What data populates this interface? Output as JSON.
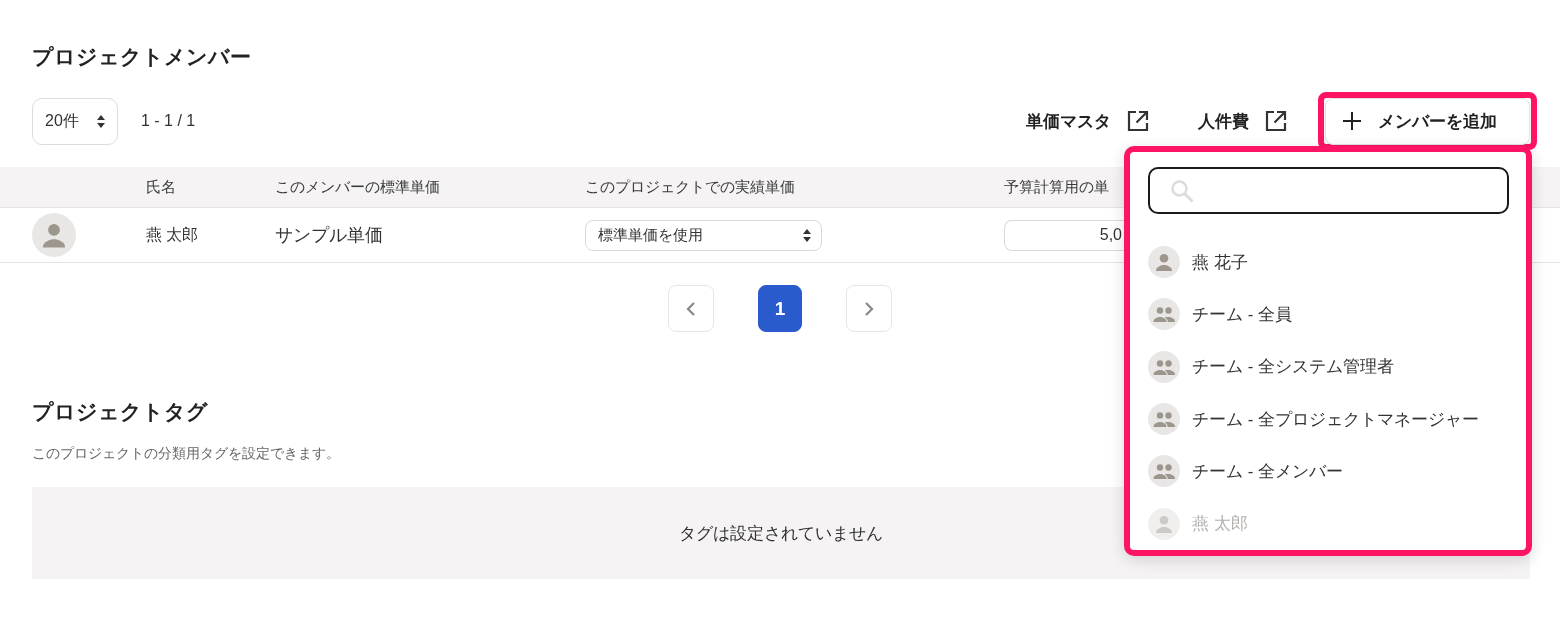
{
  "members": {
    "title": "プロジェクトメンバー",
    "page_size": "20件",
    "range": "1 - 1 / 1",
    "links": [
      {
        "label": "単価マスタ"
      },
      {
        "label": "人件費"
      }
    ],
    "add_button": {
      "label": "メンバーを追加",
      "highlighted": true
    }
  },
  "member_picker": {
    "highlighted": true,
    "items": [
      {
        "name": "燕 花子",
        "kind": "person",
        "disabled": false
      },
      {
        "name": "チーム - 全員",
        "kind": "team",
        "disabled": false
      },
      {
        "name": "チーム - 全システム管理者",
        "kind": "team",
        "disabled": false
      },
      {
        "name": "チーム - 全プロジェクトマネージャー",
        "kind": "team",
        "disabled": false
      },
      {
        "name": "チーム - 全メンバー",
        "kind": "team",
        "disabled": false
      },
      {
        "name": "燕 太郎",
        "kind": "person",
        "disabled": true
      }
    ]
  },
  "table": {
    "columns": [
      "氏名",
      "このメンバーの標準単価",
      "このプロジェクトでの実績単価",
      "予算計算用の単"
    ],
    "rows": [
      {
        "name": "燕 太郎",
        "standard_rate": "サンプル単価",
        "project_rate": "標準単価を使用",
        "budget_rate": "5,0"
      }
    ]
  },
  "pagination": {
    "pages": [
      {
        "label": "1",
        "selected": true
      }
    ]
  },
  "tags": {
    "title": "プロジェクトタグ",
    "description": "このプロジェクトの分類用タグを設定できます。",
    "empty_message": "タグは設定されていません"
  }
}
